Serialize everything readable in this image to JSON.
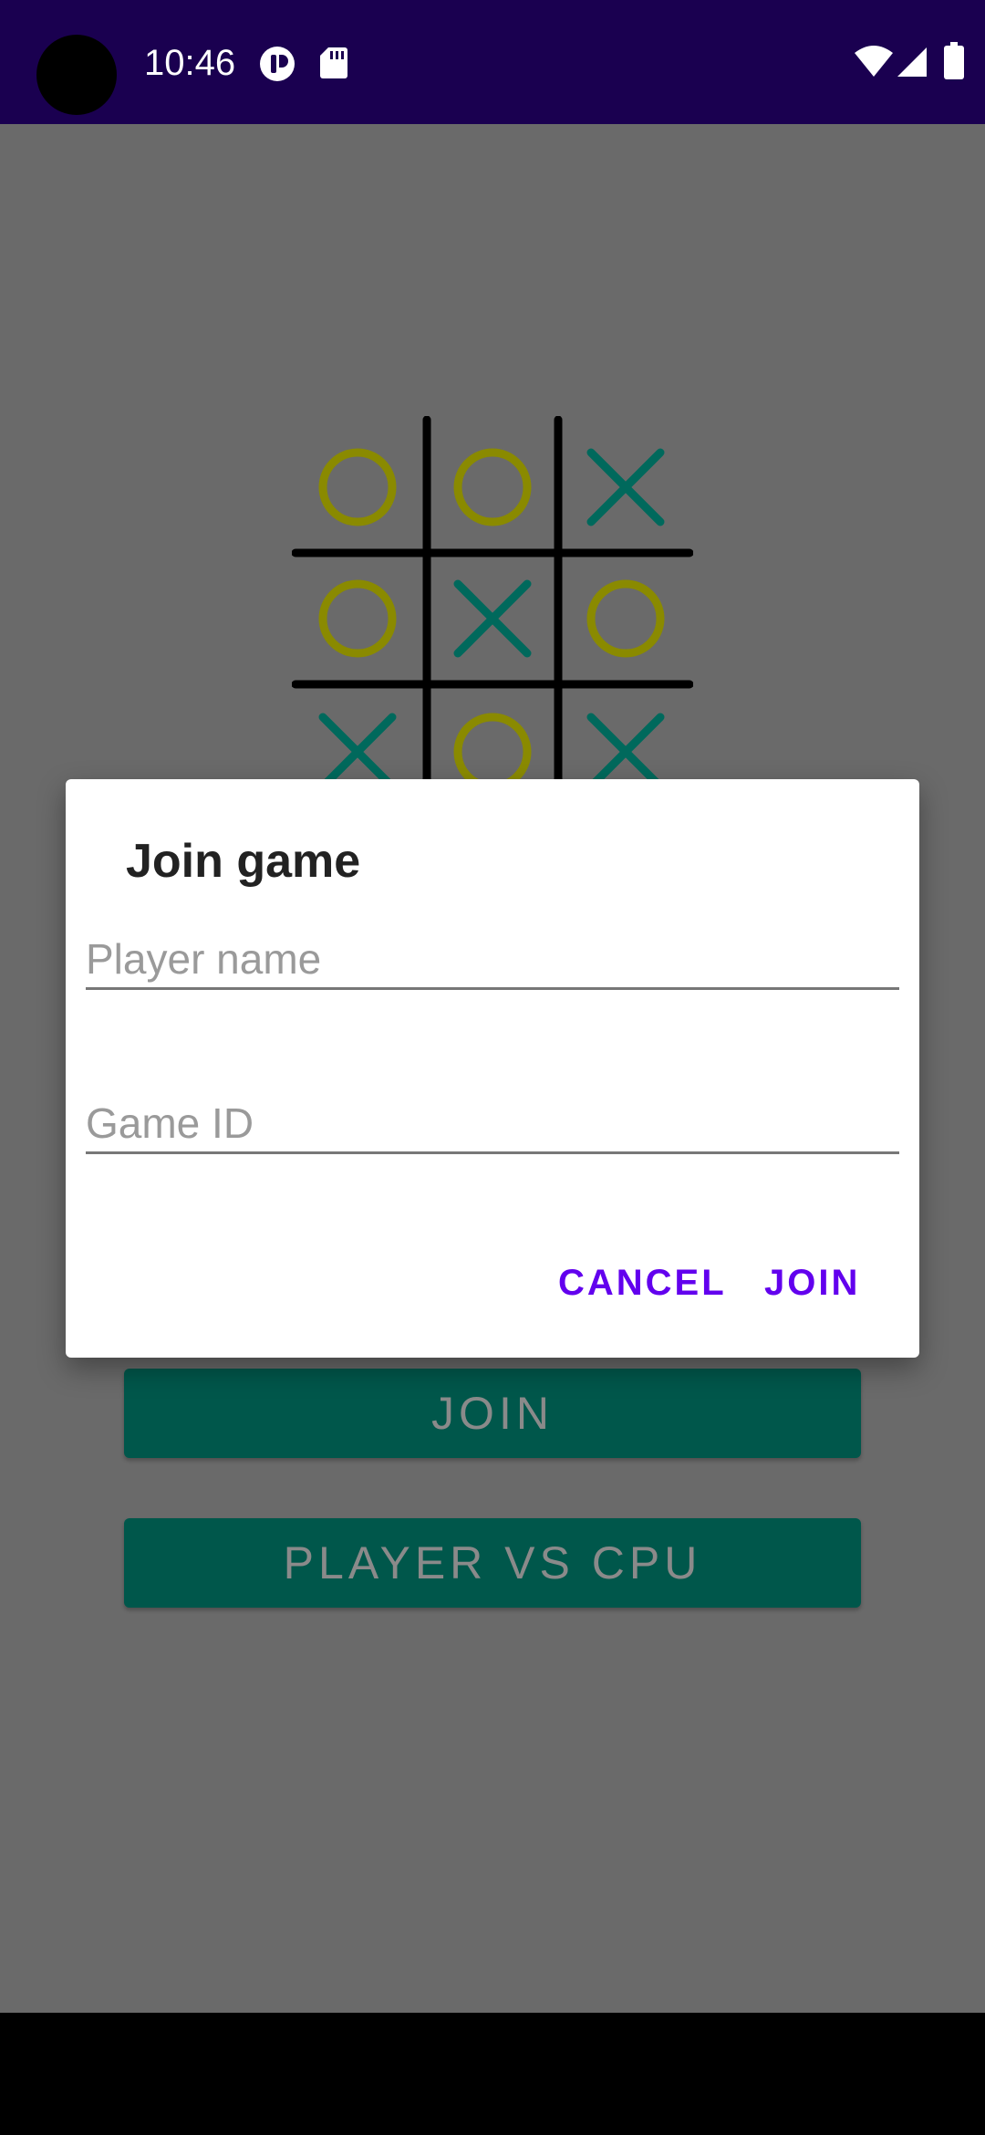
{
  "status_bar": {
    "time": "10:46",
    "icons": [
      "camera-cutout",
      "notification-icon",
      "sd-card-icon",
      "wifi-icon",
      "signal-icon",
      "battery-icon"
    ]
  },
  "board": {
    "cells": [
      "O",
      "O",
      "X",
      "O",
      "X",
      "O",
      "X",
      "O",
      "X"
    ],
    "colors": {
      "o": "#8a8a00",
      "x": "#00695c",
      "grid": "#000000"
    }
  },
  "main": {
    "join_label": "JOIN",
    "cpu_label": "PLAYER VS CPU"
  },
  "dialog": {
    "title": "Join game",
    "player_name": {
      "value": "",
      "placeholder": "Player name"
    },
    "game_id": {
      "value": "",
      "placeholder": "Game ID"
    },
    "cancel_label": "CANCEL",
    "join_label": "JOIN",
    "accent": "#6200ee"
  },
  "colors": {
    "status_bar": "#1a0050",
    "scrim_background": "#6a6a6a",
    "button": "#00574b"
  }
}
